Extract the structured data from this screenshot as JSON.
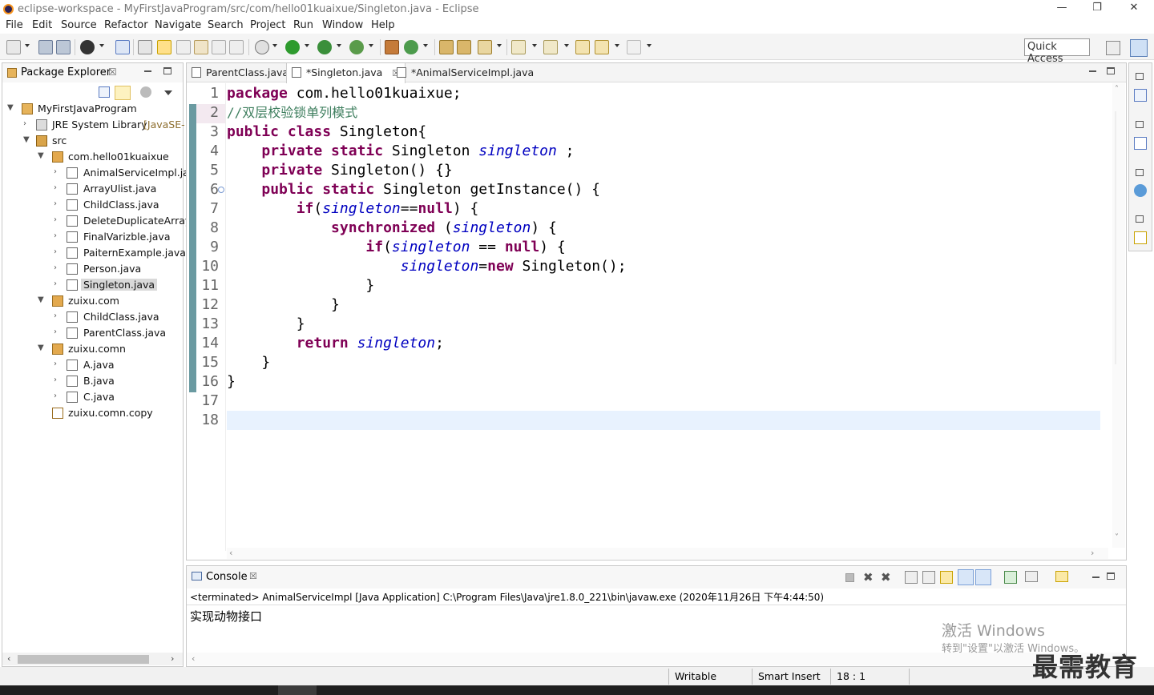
{
  "window": {
    "title": "eclipse-workspace - MyFirstJavaProgram/src/com/hello01kuaixue/Singleton.java - Eclipse",
    "min": "—",
    "max": "❐",
    "close": "✕"
  },
  "menu": [
    "File",
    "Edit",
    "Source",
    "Refactor",
    "Navigate",
    "Search",
    "Project",
    "Run",
    "Window",
    "Help"
  ],
  "quick_access": "Quick Access",
  "package_explorer": {
    "title": "Package Explorer",
    "close_glyph": "☒",
    "project": "MyFirstJavaProgram",
    "jre": "JRE System Library",
    "jre_suffix": "[JavaSE-",
    "src": "src",
    "pkg1": "com.hello01kuaixue",
    "pkg1_files": [
      "AnimalServiceImpl.ja",
      "ArrayUlist.java",
      "ChildClass.java",
      "DeleteDuplicateArray",
      "FinalVarizble.java",
      "PaiternExample.java",
      "Person.java",
      "Singleton.java"
    ],
    "pkg2": "zuixu.com",
    "pkg2_files": [
      "ChildClass.java",
      "ParentClass.java"
    ],
    "pkg3": "zuixu.comn",
    "pkg3_files": [
      "A.java",
      "B.java",
      "C.java"
    ],
    "pkg4": "zuixu.comn.copy"
  },
  "editor": {
    "tabs": [
      "ParentClass.java",
      "*Singleton.java",
      "*AnimalServiceImpl.java"
    ],
    "line_numbers": [
      "1",
      "2",
      "3",
      "4",
      "5",
      "6",
      "7",
      "8",
      "9",
      "10",
      "11",
      "12",
      "13",
      "14",
      "15",
      "16",
      "17",
      "18"
    ],
    "code": {
      "l1_kw": "package",
      "l1_rest": " com.hello01kuaixue;",
      "l2_cmt": "//双层校验锁单列模式",
      "l3_kw": "public class",
      "l3_rest": " Singleton{",
      "l4_kw": "private static",
      "l4_type": " Singleton ",
      "l4_fld": "singleton",
      "l4_end": " ;",
      "l5_kw": "private",
      "l5_rest": " Singleton() {}",
      "l6_kw": "public static",
      "l6_rest": " Singleton getInstance() {",
      "l7_kw": "if",
      "l7_a": "(",
      "l7_fld": "singleton",
      "l7_b": "==",
      "l7_null": "null",
      "l7_c": ") {",
      "l8_kw": "synchronized",
      "l8_a": " (",
      "l8_fld": "singleton",
      "l8_b": ") {",
      "l9_kw": "if",
      "l9_a": "(",
      "l9_fld": "singleton",
      "l9_b": " == ",
      "l9_null": "null",
      "l9_c": ") {",
      "l10_fld": "singleton",
      "l10_a": "=",
      "l10_new": "new",
      "l10_b": " Singleton();",
      "l11": "}",
      "l12": "}",
      "l13": "}",
      "l14_kw": "return",
      "l14_fld": "singleton",
      "l14_end": ";",
      "l15": "}",
      "l16": "}"
    }
  },
  "console": {
    "title": "Console",
    "status": "<terminated> AnimalServiceImpl [Java Application] C:\\Program Files\\Java\\jre1.8.0_221\\bin\\javaw.exe (2020年11月26日 下午4:44:50)",
    "output": "实现动物接口"
  },
  "status_bar": {
    "writable": "Writable",
    "insert": "Smart Insert",
    "position": "18 : 1"
  },
  "watermark": {
    "activate_title": "激活 Windows",
    "activate_sub": "转到\"设置\"以激活 Windows。",
    "brand": "最需教育"
  },
  "colors": {
    "keyword": "#7f0055",
    "field": "#0000c0",
    "comment": "#3f7f5f",
    "current_line": "#e8f2fe"
  }
}
